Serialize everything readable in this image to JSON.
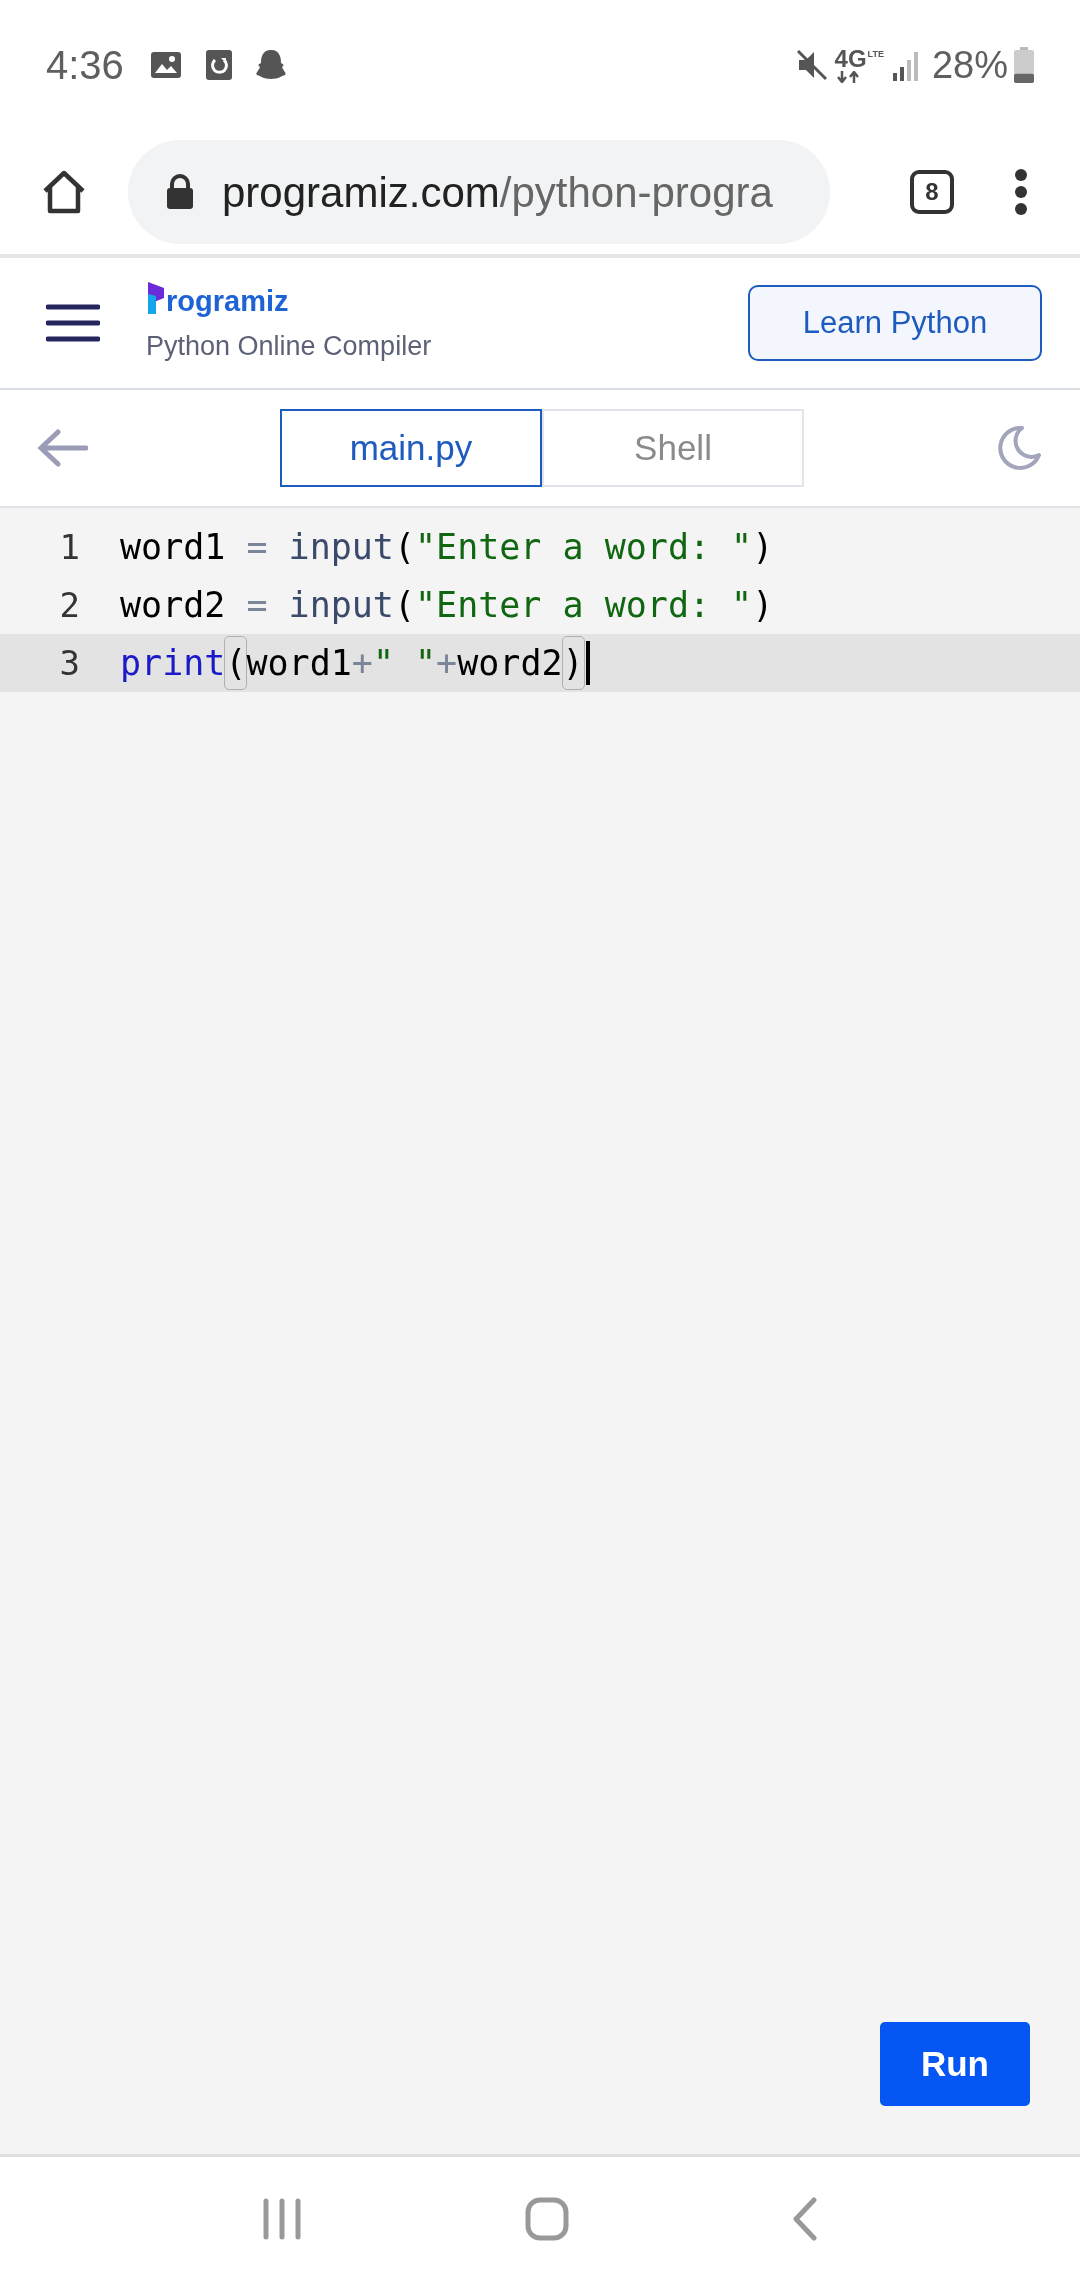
{
  "status_bar": {
    "time": "4:36",
    "network": "4G",
    "network_sub": "LTE",
    "battery": "28%",
    "battery_icon": {
      "level": 0.28
    }
  },
  "browser": {
    "url_host": "programiz.com",
    "url_path": "/python-progra",
    "tab_count": "8"
  },
  "header": {
    "logo": "rogramiz",
    "subtitle": "Python Online Compiler",
    "cta": "Learn Python"
  },
  "tabs": [
    {
      "label": "main.py",
      "selected": true
    },
    {
      "label": "Shell",
      "selected": false
    }
  ],
  "editor": {
    "lines": [
      {
        "number": "1",
        "active": false,
        "tokens": [
          {
            "text": "word1",
            "kind": "name"
          },
          {
            "text": " = ",
            "kind": "operator"
          },
          {
            "text": "input",
            "kind": "builtin"
          },
          {
            "text": "(",
            "kind": "paren"
          },
          {
            "text": "\"Enter a word: \"",
            "kind": "string"
          },
          {
            "text": ")",
            "kind": "paren"
          }
        ]
      },
      {
        "number": "2",
        "active": false,
        "tokens": [
          {
            "text": "word2",
            "kind": "name"
          },
          {
            "text": " = ",
            "kind": "operator"
          },
          {
            "text": "input",
            "kind": "builtin"
          },
          {
            "text": "(",
            "kind": "paren"
          },
          {
            "text": "\"Enter a word: \"",
            "kind": "string"
          },
          {
            "text": ")",
            "kind": "paren"
          }
        ]
      },
      {
        "number": "3",
        "active": true,
        "tokens": [
          {
            "text": "print",
            "kind": "keyword"
          },
          {
            "text": "(",
            "kind": "matched"
          },
          {
            "text": "word1",
            "kind": "name"
          },
          {
            "text": "+",
            "kind": "operator"
          },
          {
            "text": "\" \"",
            "kind": "string"
          },
          {
            "text": "+",
            "kind": "operator"
          },
          {
            "text": "word2",
            "kind": "name"
          },
          {
            "text": ")",
            "kind": "matched"
          }
        ]
      }
    ]
  },
  "run_button": "Run"
}
